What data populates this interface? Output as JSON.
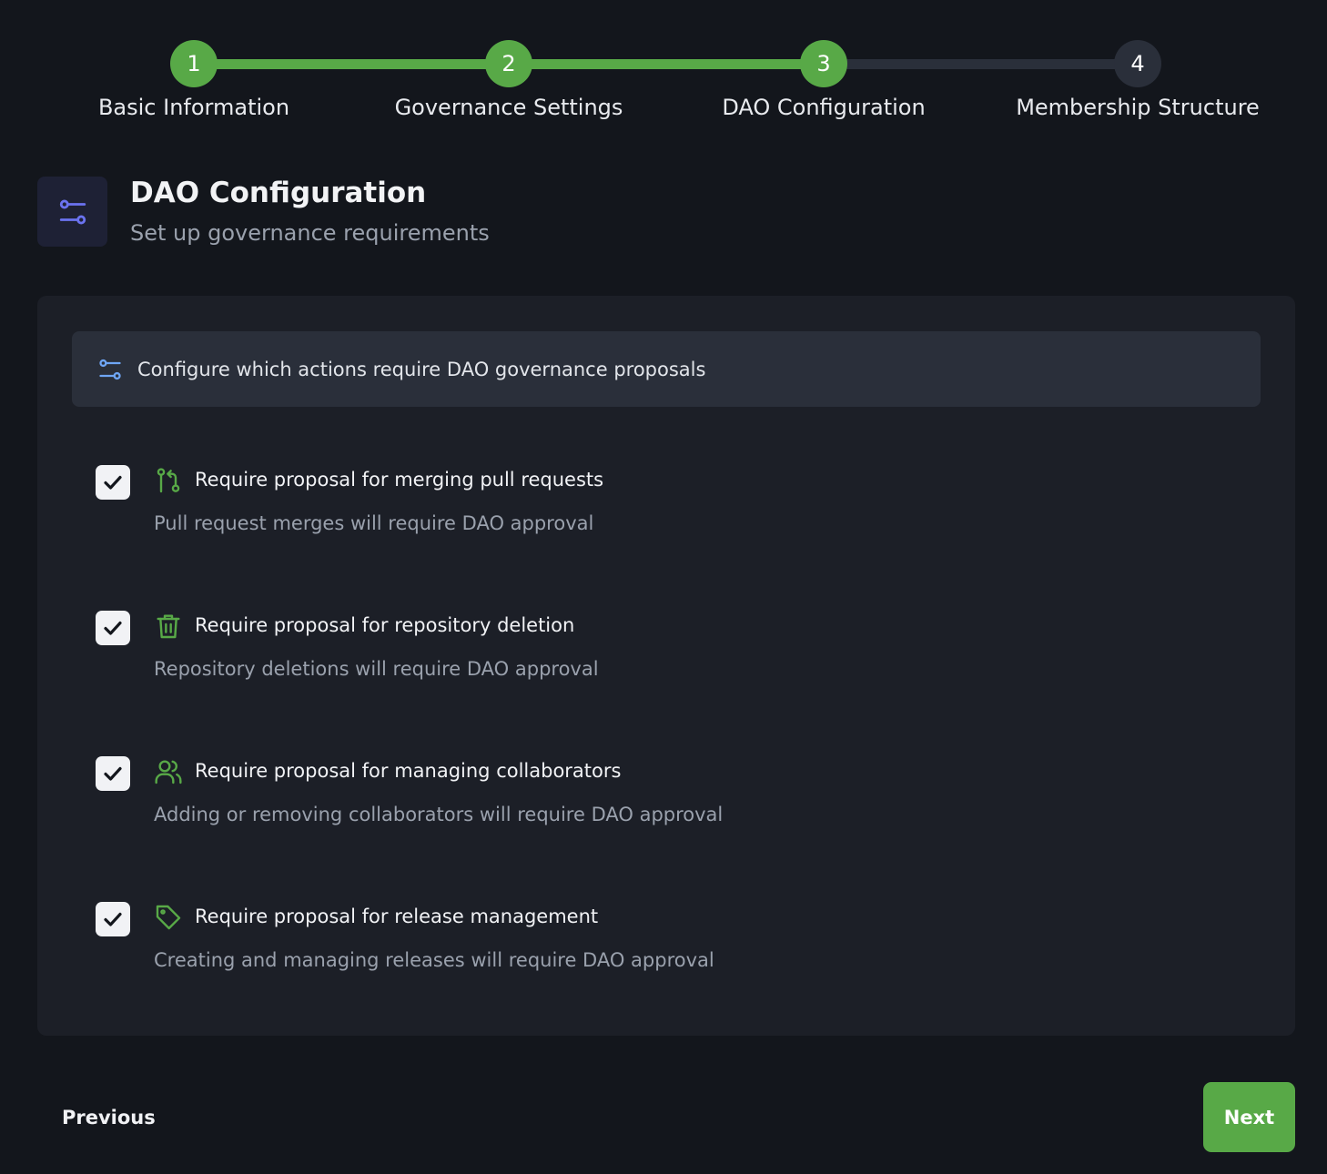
{
  "colors": {
    "accent_green": "#58a947",
    "track_inactive": "#2a2f3a",
    "background": "#13161c",
    "card": "#1c1f27",
    "info_bar": "#2a2f3a",
    "header_icon": "#6b73f0",
    "info_icon": "#6fa6f5"
  },
  "stepper": {
    "current_step": 3,
    "steps": [
      {
        "number": "1",
        "label": "Basic Information",
        "status": "complete"
      },
      {
        "number": "2",
        "label": "Governance Settings",
        "status": "complete"
      },
      {
        "number": "3",
        "label": "DAO Configuration",
        "status": "current"
      },
      {
        "number": "4",
        "label": "Membership Structure",
        "status": "upcoming"
      }
    ]
  },
  "header": {
    "icon": "sliders-icon",
    "title": "DAO Configuration",
    "subtitle": "Set up governance requirements"
  },
  "info": {
    "icon": "sliders-icon",
    "text": "Configure which actions require DAO governance proposals"
  },
  "options": [
    {
      "icon": "git-pull-request-icon",
      "label": "Require proposal for merging pull requests",
      "description": "Pull request merges will require DAO approval",
      "checked": true
    },
    {
      "icon": "trash-icon",
      "label": "Require proposal for repository deletion",
      "description": "Repository deletions will require DAO approval",
      "checked": true
    },
    {
      "icon": "users-icon",
      "label": "Require proposal for managing collaborators",
      "description": "Adding or removing collaborators will require DAO approval",
      "checked": true
    },
    {
      "icon": "tag-icon",
      "label": "Require proposal for release management",
      "description": "Creating and managing releases will require DAO approval",
      "checked": true
    }
  ],
  "footer": {
    "previous_label": "Previous",
    "next_label": "Next"
  }
}
